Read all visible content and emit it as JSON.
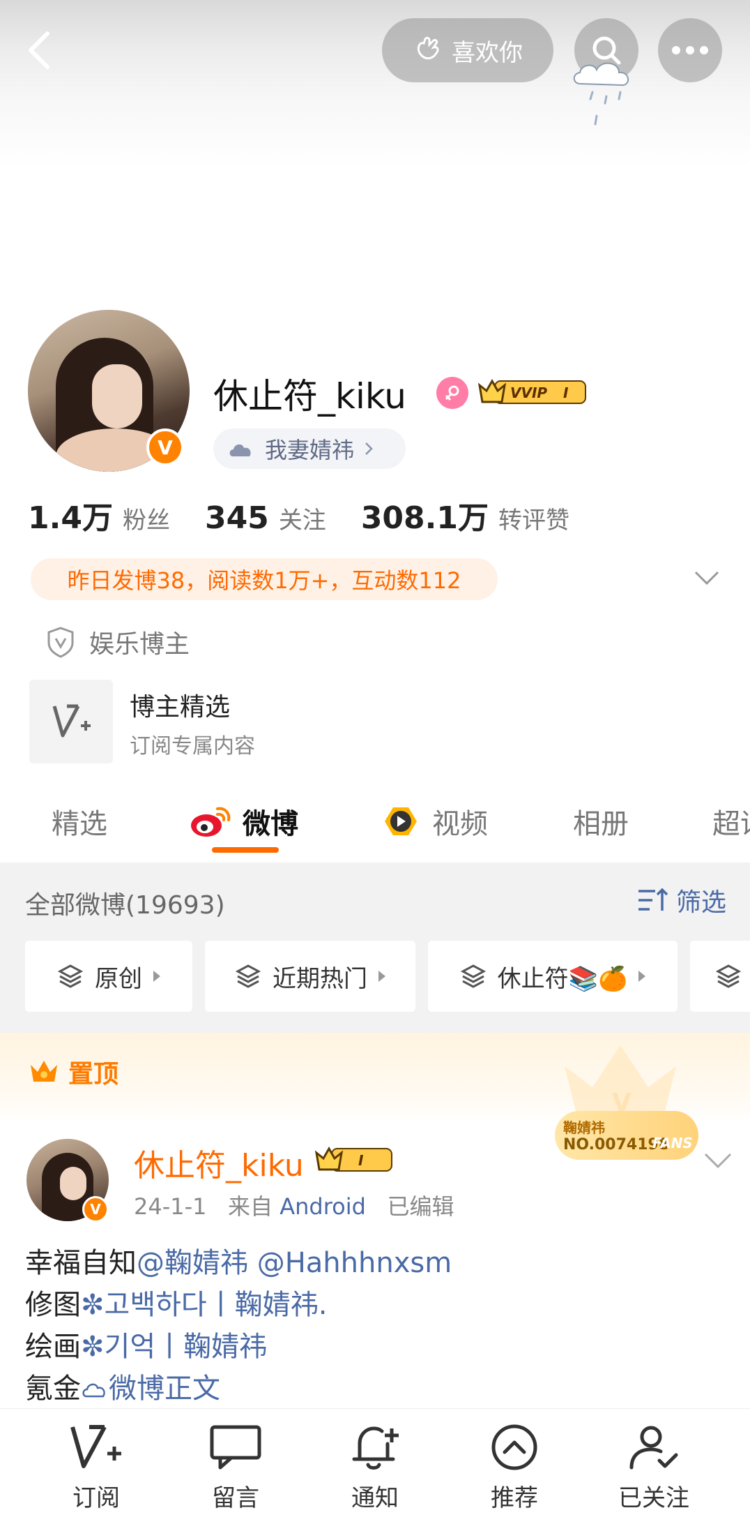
{
  "header": {
    "like_label": "喜欢你"
  },
  "profile": {
    "name": "休止符_kiku",
    "vip_badge": "VVIP",
    "vip_level": "I",
    "group_label": "我妻婧祎",
    "stats": [
      {
        "value": "1.4万",
        "label": "粉丝"
      },
      {
        "value": "345",
        "label": "关注"
      },
      {
        "value": "308.1万",
        "label": "转评赞"
      }
    ],
    "activity": "昨日发博38，阅读数1万+，互动数112",
    "category": "娱乐博主",
    "feature": {
      "title": "博主精选",
      "subtitle": "订阅专属内容"
    }
  },
  "tabs": [
    {
      "label": "精选"
    },
    {
      "label": "微博"
    },
    {
      "label": "视频"
    },
    {
      "label": "相册"
    },
    {
      "label": "超话"
    }
  ],
  "feed": {
    "count_label": "全部微博(19693)",
    "filter_label": "筛选",
    "chips": [
      "原创",
      "近期热门",
      "休止符📚🍊"
    ]
  },
  "pinned": {
    "label": "置顶",
    "fans_card": {
      "name": "鞠婧祎",
      "number": "NO.0074198",
      "tag": "FANS"
    },
    "post": {
      "user": "休止符_kiku",
      "vip_level": "I",
      "date": "24-1-1",
      "source_prefix": "来自",
      "source": "Android",
      "edited": "已编辑",
      "lines": [
        {
          "text": "幸福自知",
          "link": "@鞠婧祎 @Hahhhnxsm"
        },
        {
          "text": "修图",
          "link": "고백하다丨鞠婧祎."
        },
        {
          "text": "绘画",
          "link": "기억丨鞠婧祎"
        },
        {
          "text": "氪金",
          "link": "微博正文"
        }
      ]
    }
  },
  "bottom_nav": [
    {
      "label": "订阅",
      "icon": "subscribe-v-icon"
    },
    {
      "label": "留言",
      "icon": "message-icon"
    },
    {
      "label": "通知",
      "icon": "bell-plus-icon"
    },
    {
      "label": "推荐",
      "icon": "up-circle-icon"
    },
    {
      "label": "已关注",
      "icon": "user-check-icon"
    }
  ],
  "colors": {
    "accent": "#ff6a00",
    "link": "#4a6aa6"
  }
}
